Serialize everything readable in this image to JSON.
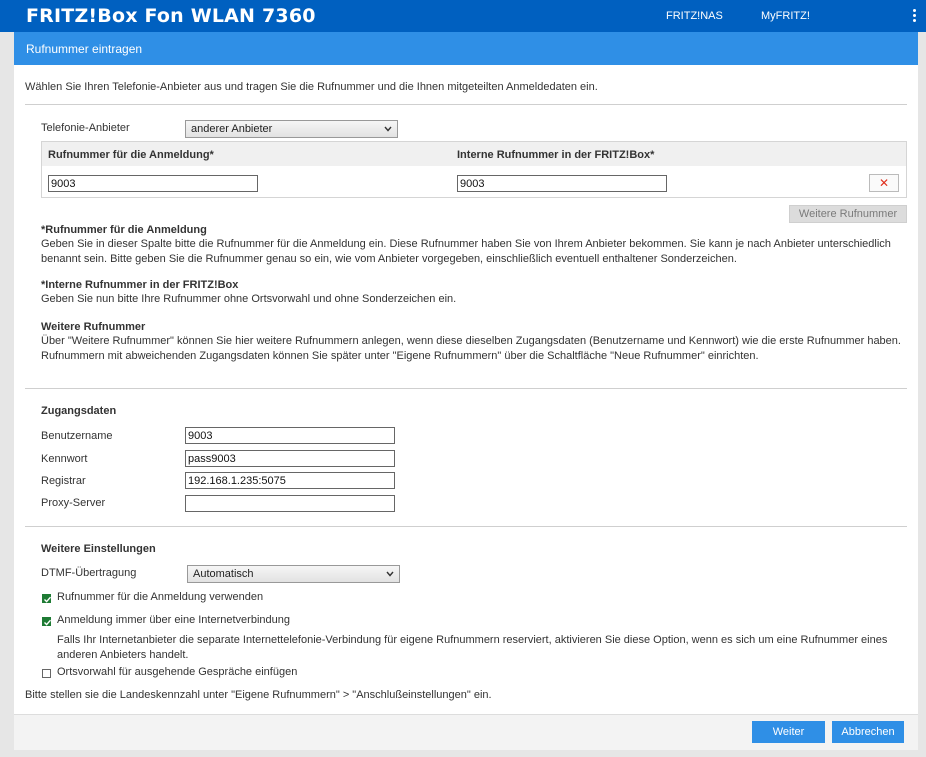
{
  "app": {
    "title": "FRITZ!Box Fon WLAN 7360",
    "links": {
      "nas": "FRITZ!NAS",
      "myfritz": "MyFRITZ!"
    },
    "menu_icon": "kebab-menu-icon"
  },
  "page": {
    "title": "Rufnummer eintragen",
    "intro": "Wählen Sie Ihren Telefonie-Anbieter aus und tragen Sie die Rufnummer und die Ihnen mitgeteilten Anmeldedaten ein."
  },
  "provider": {
    "label": "Telefonie-Anbieter",
    "selected": "anderer Anbieter"
  },
  "numbers_table": {
    "col_login": "Rufnummer für die Anmeldung*",
    "col_internal": "Interne Rufnummer in der FRITZ!Box*",
    "row": {
      "login": "9003",
      "internal": "9003",
      "delete_symbol": "✕"
    },
    "more_button": "Weitere Rufnummer"
  },
  "help": {
    "login_title": "*Rufnummer für die Anmeldung",
    "login_text": "Geben Sie in dieser Spalte bitte die Rufnummer für die Anmeldung ein. Diese Rufnummer haben Sie von Ihrem Anbieter bekommen. Sie kann je nach Anbieter unterschiedlich benannt sein. Bitte geben Sie die Rufnummer genau so ein, wie vom Anbieter vorgegeben, einschließlich eventuell enthaltener Sonderzeichen.",
    "internal_title": "*Interne Rufnummer in der FRITZ!Box",
    "internal_text": "Geben Sie nun bitte Ihre Rufnummer ohne Ortsvorwahl und ohne Sonderzeichen ein.",
    "more_title": "Weitere Rufnummer",
    "more_text": "Über \"Weitere Rufnummer\" können Sie hier weitere Rufnummern anlegen, wenn diese dieselben Zugangsdaten (Benutzername und Kennwort) wie die erste Rufnummer haben. Rufnummern mit abweichenden Zugangsdaten können Sie später unter \"Eigene Rufnummern\" über die Schaltfläche \"Neue Rufnummer\" einrichten."
  },
  "access": {
    "title": "Zugangsdaten",
    "username_label": "Benutzername",
    "username_value": "9003",
    "password_label": "Kennwort",
    "password_value": "pass9003",
    "registrar_label": "Registrar",
    "registrar_value": "192.168.1.235:5075",
    "proxy_label": "Proxy-Server",
    "proxy_value": ""
  },
  "settings": {
    "title": "Weitere Einstellungen",
    "dtmf_label": "DTMF-Übertragung",
    "dtmf_selected": "Automatisch",
    "opt_use_login_number": {
      "label": "Rufnummer für die Anmeldung verwenden",
      "checked": true
    },
    "opt_internet": {
      "label": "Anmeldung immer über eine Internetverbindung",
      "checked": true
    },
    "opt_internet_note": "Falls Ihr Internetanbieter die separate Internettelefonie-Verbindung für eigene Rufnummern reserviert, aktivieren Sie diese Option, wenn es sich um eine Rufnummer eines anderen Anbieters handelt.",
    "opt_area_code": {
      "label": "Ortsvorwahl für ausgehende Gespräche einfügen",
      "checked": false
    },
    "country_hint": "Bitte stellen sie die Landeskennzahl unter \"Eigene Rufnummern\" > \"Anschlußeinstellungen\" ein."
  },
  "footer": {
    "next": "Weiter",
    "cancel": "Abbrechen"
  },
  "colors": {
    "topbar": "#0060c0",
    "subheader": "#2f8fe6",
    "button_primary": "#2f8fe6",
    "checkbox_on": "#1e7b34",
    "delete_icon": "#e0301e"
  }
}
